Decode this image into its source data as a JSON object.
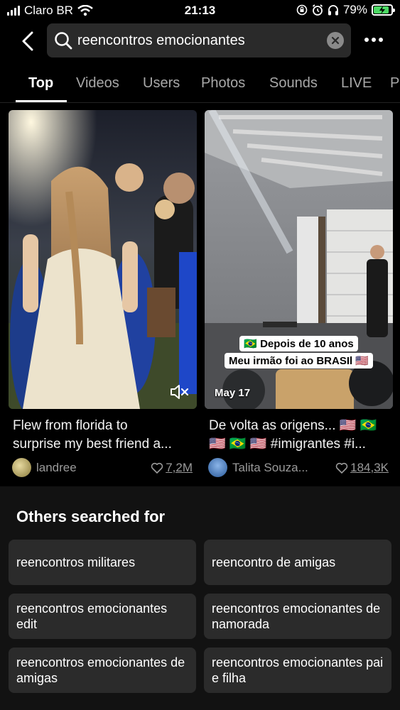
{
  "status_bar": {
    "carrier": "Claro BR",
    "time": "21:13",
    "battery": "79%",
    "battery_level": 0.79
  },
  "search": {
    "query": "reencontros emocionantes"
  },
  "tabs": [
    "Top",
    "Videos",
    "Users",
    "Photos",
    "Sounds",
    "LIVE",
    "P"
  ],
  "results": [
    {
      "caption_line1": "Flew from florida to",
      "caption_line2": "surprise my best friend a...",
      "author": "landree",
      "likes": "7,2M"
    },
    {
      "caption_line1": "De volta as origens... 🇺🇸 🇧🇷",
      "caption_line2": "🇺🇸 🇧🇷 🇺🇸   #imigrantes #i...",
      "author": "Talita Souza...",
      "likes": "184,3K",
      "date": "May 17",
      "overlay_line1": "🇧🇷 Depois de 10 anos",
      "overlay_line2": "Meu irmão foi ao BRASIl 🇺🇸"
    }
  ],
  "others": {
    "title": "Others searched for",
    "items": [
      "reencontros militares",
      "reencontro de amigas",
      "reencontros emocionantes edit",
      "reencontros emocionantes de namorada",
      "reencontros emocionantes de amigas",
      "reencontros emocionantes pai e filha"
    ]
  },
  "icons": [
    "signal-icon",
    "wifi-icon",
    "lock-rotation-icon",
    "alarm-icon",
    "headphones-icon",
    "battery-icon",
    "back-icon",
    "search-icon",
    "clear-icon",
    "more-icon",
    "mute-icon",
    "heart-icon"
  ]
}
